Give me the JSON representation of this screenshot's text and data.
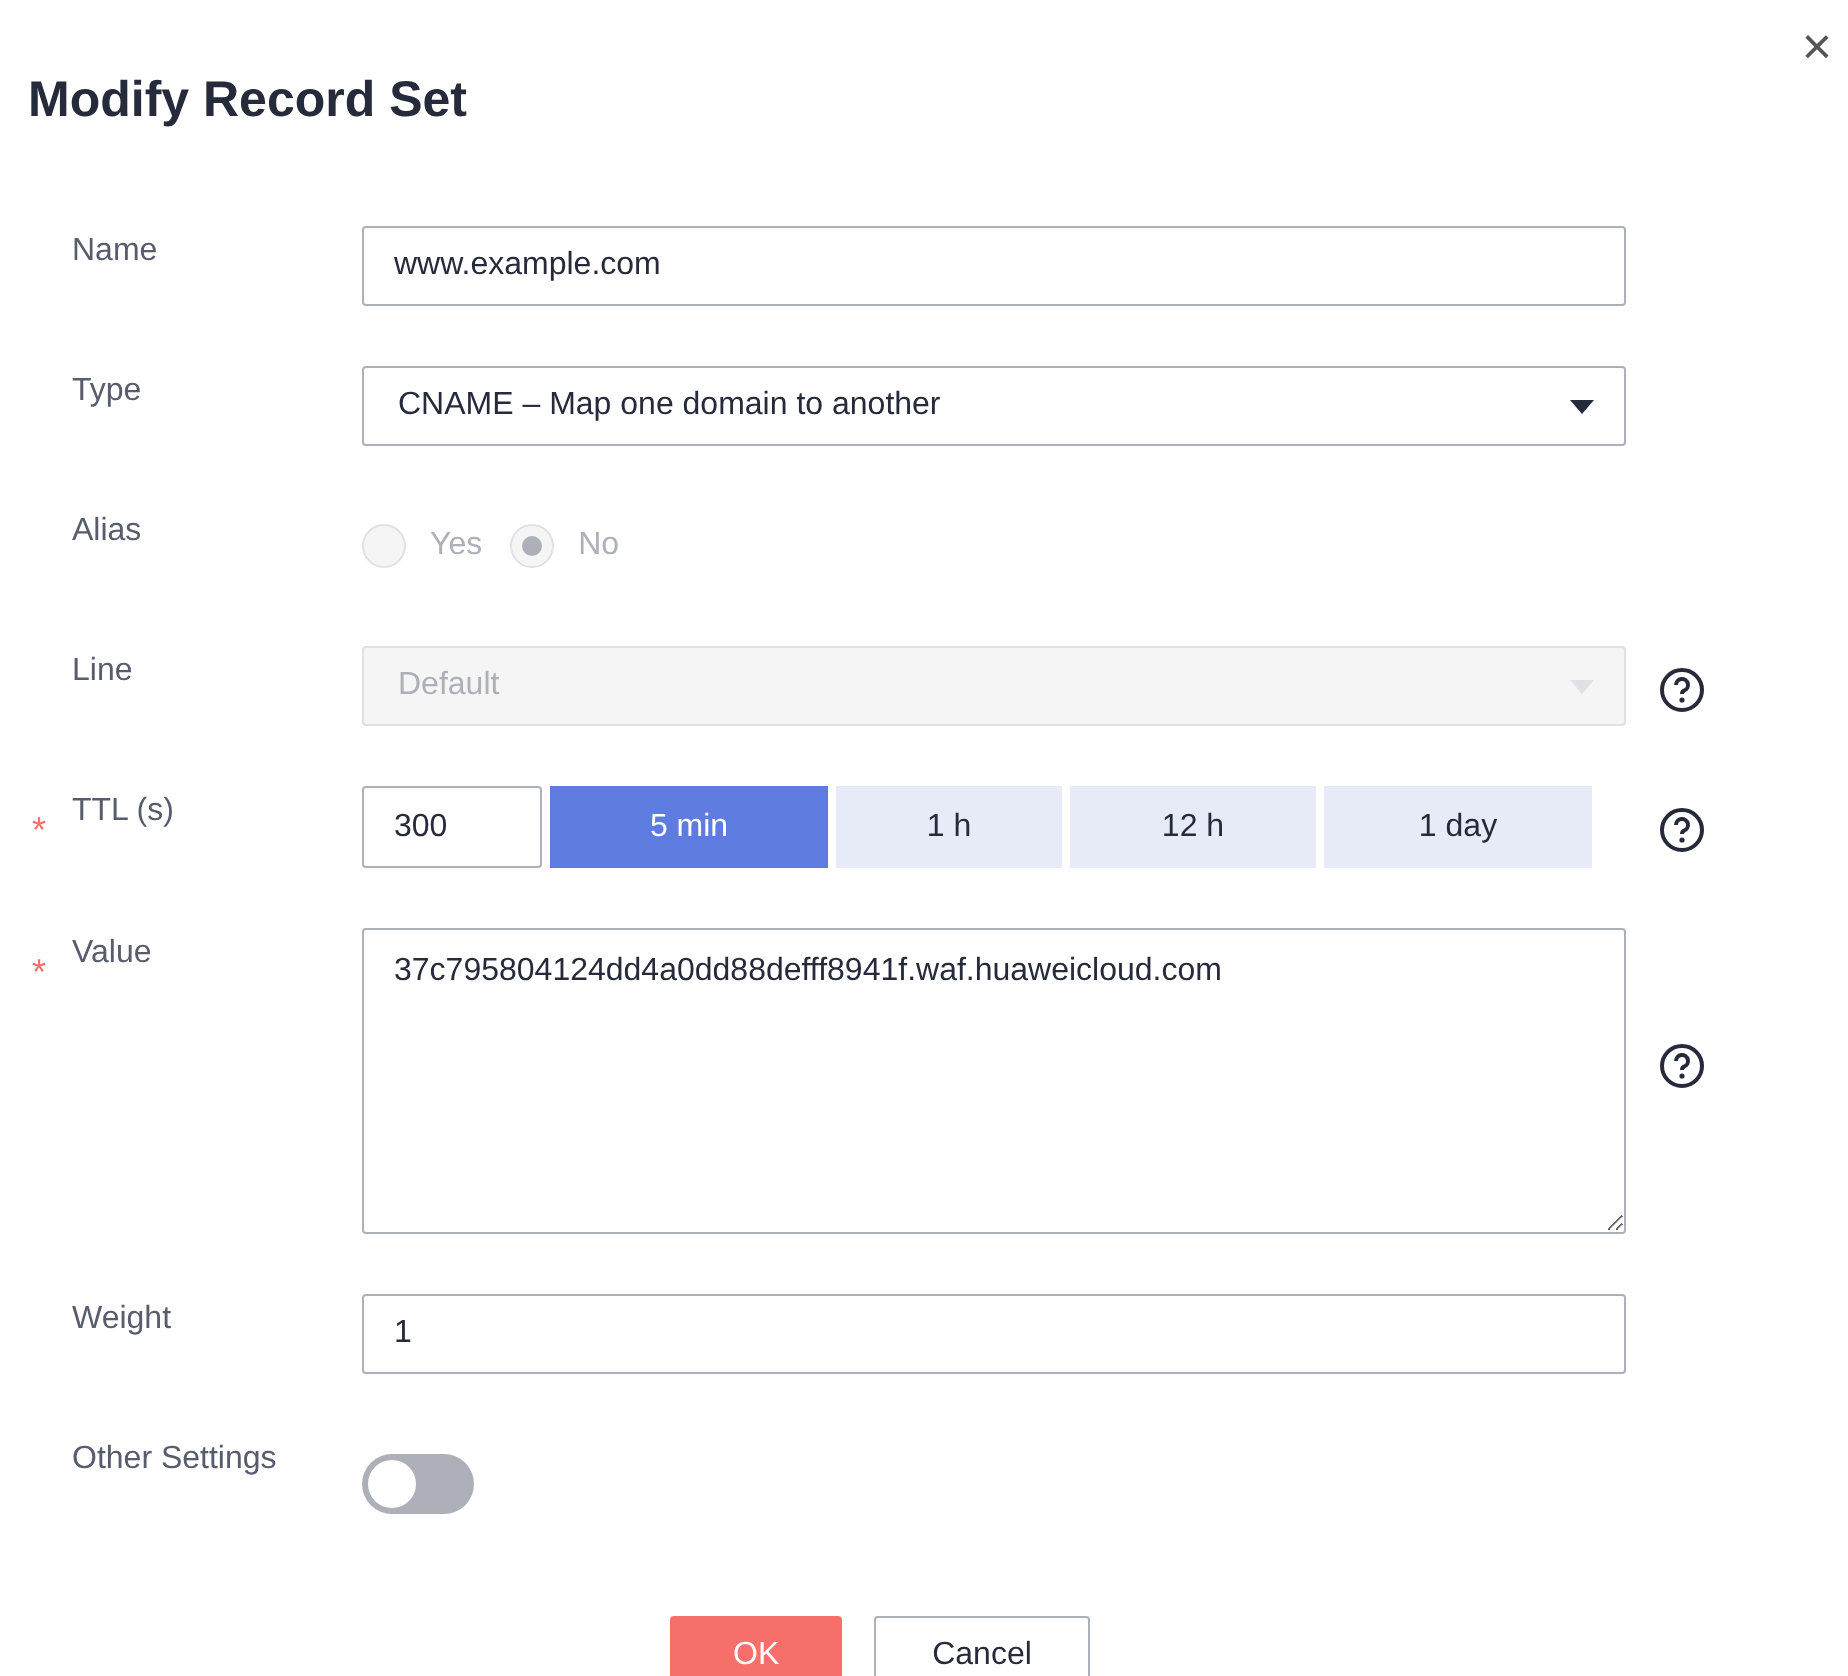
{
  "dialog": {
    "title": "Modify Record Set",
    "close": "×"
  },
  "fields": [
    {
      "kind": "text",
      "label": "Name",
      "value": "www.example.com",
      "help": false
    },
    {
      "kind": "select",
      "label": "Type",
      "value": "CNAME – Map one domain to another",
      "disabled": false,
      "help": false
    },
    {
      "kind": "radio",
      "label": "Alias",
      "disabled": true,
      "options": [
        {
          "label": "Yes",
          "selected": false
        },
        {
          "label": "No",
          "selected": true
        }
      ],
      "help": false
    },
    {
      "kind": "select",
      "label": "Line",
      "value": "Default",
      "disabled": true,
      "help": true
    },
    {
      "kind": "ttl",
      "label": "TTL (s)",
      "required_mark": "*",
      "value": "300",
      "presets": [
        {
          "label": "5 min",
          "selected": true
        },
        {
          "label": "1 h",
          "selected": false
        },
        {
          "label": "12 h",
          "selected": false
        },
        {
          "label": "1 day",
          "selected": false
        }
      ],
      "help": true
    },
    {
      "kind": "textarea",
      "label": "Value",
      "required_mark": "*",
      "value": "37c795804124dd4a0dd88defff8941f.waf.huaweicloud.com",
      "help": true
    },
    {
      "kind": "text",
      "label": "Weight",
      "value": "1",
      "help": false
    },
    {
      "kind": "toggle",
      "label": "Other Settings",
      "on": false,
      "help": false
    }
  ],
  "buttons": [
    {
      "label": "OK",
      "primary": true
    },
    {
      "label": "Cancel",
      "primary": false
    }
  ]
}
